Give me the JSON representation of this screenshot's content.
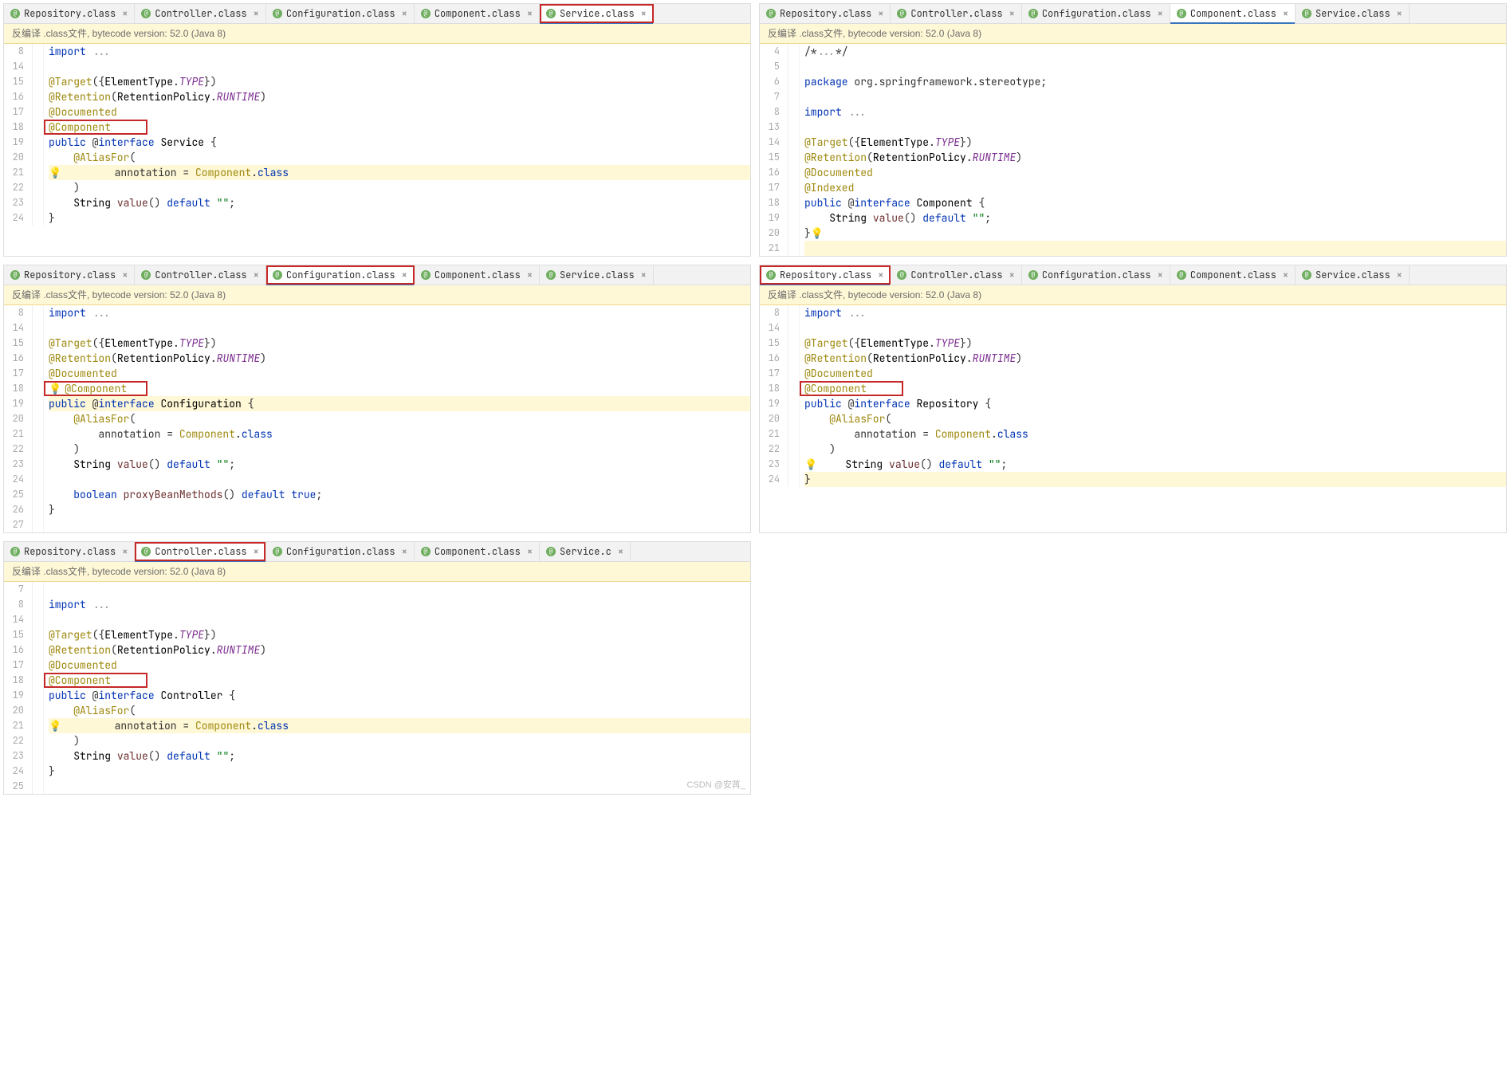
{
  "banner": "反编译 .class文件, bytecode version: 52.0 (Java 8)",
  "tabs": [
    "Repository.class",
    "Controller.class",
    "Configuration.class",
    "Component.class",
    "Service.class"
  ],
  "tabs_p5": [
    "Repository.class",
    "Controller.class",
    "Configuration.class",
    "Component.class",
    "Service.c"
  ],
  "watermark": "CSDN @安苒_",
  "p1": {
    "active_tab": 4,
    "hl_tab_index": 4,
    "lines_no": [
      8,
      14,
      15,
      16,
      17,
      18,
      19,
      20,
      21,
      22,
      23,
      24
    ],
    "code": [
      {
        "t": "import ...",
        "cls": ""
      },
      {
        "t": "",
        "cls": ""
      },
      {
        "t": "@Target({ElementType.TYPE})",
        "cls": ""
      },
      {
        "t": "@Retention(RetentionPolicy.RUNTIME)",
        "cls": ""
      },
      {
        "t": "@Documented",
        "cls": ""
      },
      {
        "t": "@Component",
        "cls": "box"
      },
      {
        "t": "public @interface Service {",
        "cls": ""
      },
      {
        "t": "    @AliasFor(",
        "cls": ""
      },
      {
        "t": "        annotation = Component.class",
        "cls": "hl",
        "bulb": true
      },
      {
        "t": "    )",
        "cls": ""
      },
      {
        "t": "    String value() default \"\";",
        "cls": ""
      },
      {
        "t": "}",
        "cls": ""
      }
    ]
  },
  "p2": {
    "active_tab": 3,
    "lines_no": [
      4,
      5,
      6,
      7,
      8,
      13,
      14,
      15,
      16,
      17,
      18,
      19,
      20,
      21
    ],
    "code": [
      {
        "t": "/*...*/",
        "cls": ""
      },
      {
        "t": "",
        "cls": ""
      },
      {
        "t": "package org.springframework.stereotype;",
        "cls": ""
      },
      {
        "t": "",
        "cls": ""
      },
      {
        "t": "import ...",
        "cls": ""
      },
      {
        "t": "",
        "cls": ""
      },
      {
        "t": "@Target({ElementType.TYPE})",
        "cls": ""
      },
      {
        "t": "@Retention(RetentionPolicy.RUNTIME)",
        "cls": ""
      },
      {
        "t": "@Documented",
        "cls": ""
      },
      {
        "t": "@Indexed",
        "cls": ""
      },
      {
        "t": "public @interface Component {",
        "cls": ""
      },
      {
        "t": "    String value() default \"\";",
        "cls": ""
      },
      {
        "t": "}",
        "cls": "",
        "bulb_after": true
      },
      {
        "t": "",
        "cls": "hl"
      }
    ]
  },
  "p3": {
    "active_tab": 2,
    "hl_tab_index": 2,
    "lines_no": [
      8,
      14,
      15,
      16,
      17,
      18,
      19,
      20,
      21,
      22,
      23,
      24,
      25,
      26,
      27
    ],
    "code": [
      {
        "t": "import ...",
        "cls": ""
      },
      {
        "t": "",
        "cls": ""
      },
      {
        "t": "@Target({ElementType.TYPE})",
        "cls": ""
      },
      {
        "t": "@Retention(RetentionPolicy.RUNTIME)",
        "cls": ""
      },
      {
        "t": "@Documented",
        "cls": ""
      },
      {
        "t": "@Component",
        "cls": "box",
        "bulb": true
      },
      {
        "t": "public @interface Configuration {",
        "cls": "hl"
      },
      {
        "t": "    @AliasFor(",
        "cls": ""
      },
      {
        "t": "        annotation = Component.class",
        "cls": ""
      },
      {
        "t": "    )",
        "cls": ""
      },
      {
        "t": "    String value() default \"\";",
        "cls": ""
      },
      {
        "t": "",
        "cls": ""
      },
      {
        "t": "    boolean proxyBeanMethods() default true;",
        "cls": ""
      },
      {
        "t": "}",
        "cls": ""
      }
    ]
  },
  "p4": {
    "active_tab": 0,
    "hl_tab_index": 0,
    "lines_no": [
      8,
      14,
      15,
      16,
      17,
      18,
      19,
      20,
      21,
      22,
      23,
      24
    ],
    "code": [
      {
        "t": "import ...",
        "cls": ""
      },
      {
        "t": "",
        "cls": ""
      },
      {
        "t": "@Target({ElementType.TYPE})",
        "cls": ""
      },
      {
        "t": "@Retention(RetentionPolicy.RUNTIME)",
        "cls": ""
      },
      {
        "t": "@Documented",
        "cls": ""
      },
      {
        "t": "@Component",
        "cls": "box"
      },
      {
        "t": "public @interface Repository {",
        "cls": ""
      },
      {
        "t": "    @AliasFor(",
        "cls": ""
      },
      {
        "t": "        annotation = Component.class",
        "cls": ""
      },
      {
        "t": "    )",
        "cls": ""
      },
      {
        "t": "    String value() default \"\";",
        "cls": "",
        "bulb": true
      },
      {
        "t": "}",
        "cls": "hl"
      }
    ]
  },
  "p5": {
    "active_tab": 1,
    "hl_tab_index": 1,
    "lines_no": [
      7,
      8,
      14,
      15,
      16,
      17,
      18,
      19,
      20,
      21,
      22,
      23,
      24,
      25
    ],
    "code": [
      {
        "t": "",
        "cls": ""
      },
      {
        "t": "import ...",
        "cls": ""
      },
      {
        "t": "",
        "cls": ""
      },
      {
        "t": "@Target({ElementType.TYPE})",
        "cls": ""
      },
      {
        "t": "@Retention(RetentionPolicy.RUNTIME)",
        "cls": ""
      },
      {
        "t": "@Documented",
        "cls": ""
      },
      {
        "t": "@Component",
        "cls": "box"
      },
      {
        "t": "public @interface Controller {",
        "cls": ""
      },
      {
        "t": "    @AliasFor(",
        "cls": ""
      },
      {
        "t": "        annotation = Component.class",
        "cls": "hl",
        "bulb": true,
        "caret": true
      },
      {
        "t": "    )",
        "cls": ""
      },
      {
        "t": "    String value() default \"\";",
        "cls": ""
      },
      {
        "t": "}",
        "cls": ""
      },
      {
        "t": "",
        "cls": ""
      }
    ]
  }
}
